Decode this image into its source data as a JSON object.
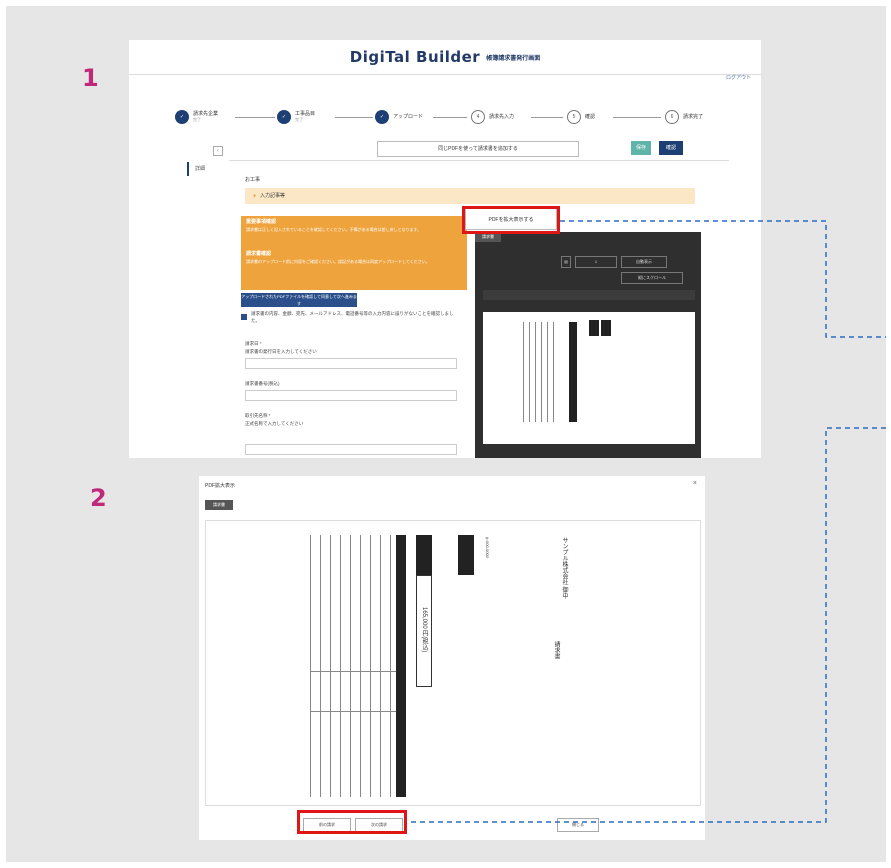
{
  "labels": {
    "step1": "1",
    "step2": "2"
  },
  "app": {
    "logo": "DigiTal Builder",
    "logo_sub": "帳簿請求書発行画面",
    "top_link": "ログアウト"
  },
  "stepper": [
    {
      "label": "請求先企業",
      "sub": "完了",
      "state": "done"
    },
    {
      "label": "工事品目",
      "sub": "完了",
      "state": "done"
    },
    {
      "label": "アップロード",
      "sub": "",
      "state": "done"
    },
    {
      "label": "請求先入力",
      "sub": "",
      "state": "todo"
    },
    {
      "label": "確認",
      "sub": "",
      "state": "todo"
    },
    {
      "label": "請求完了",
      "sub": "",
      "state": "todo"
    }
  ],
  "sidebar": {
    "item": "詳細"
  },
  "main": {
    "header_button": "同じPDFを使って請求書を追加する",
    "save": "保存",
    "next": "確認",
    "section": "お工事",
    "notice": "入力記事等",
    "warn1_title": "重要事項確認",
    "warn1_text": "請求書は正しく記入されていることを確認してください。不備がある場合は差し戻しとなります。",
    "warn2_title": "請求書確認",
    "warn2_text": "請求書のアップロード前に内容をご確認ください。誤記がある場合は再度アップロードしてください。",
    "blue_button": "アップロードされたPDFファイルを確認して同意して次へ進みます",
    "consent_text": "請求書の内容、金額、宛先、メールアドレス、電話番号等の入力内容に誤りがないことを確認しました。",
    "field1_label": "請求日 *",
    "field1_help": "請求書の発行日を入力してください",
    "field2_label": "請求書番号(税込)",
    "field3_label": "取引先名称 *",
    "field3_help": "正式名称で入力してください",
    "pdf_button": "PDFを拡大表示する"
  },
  "viewer": {
    "tab": "請求書",
    "toolbar": [
      "1",
      "ページ",
      "自動表示",
      "縦にスクロール"
    ]
  },
  "modal": {
    "title": "PDF拡大表示",
    "tab": "請求書",
    "close": "×",
    "buttons": [
      "前の請求",
      "次の請求"
    ],
    "right_button": "閉じる",
    "doc_company": "サンプル株式会社 御中",
    "doc_amount": "165,000 円(税込)",
    "doc_seal": "請求書"
  },
  "colors": {
    "accent_red": "#e01616",
    "navy": "#1e3f73",
    "orange": "#eea33d",
    "magenta": "#c0287a",
    "dash_blue": "#2d6cc0"
  }
}
